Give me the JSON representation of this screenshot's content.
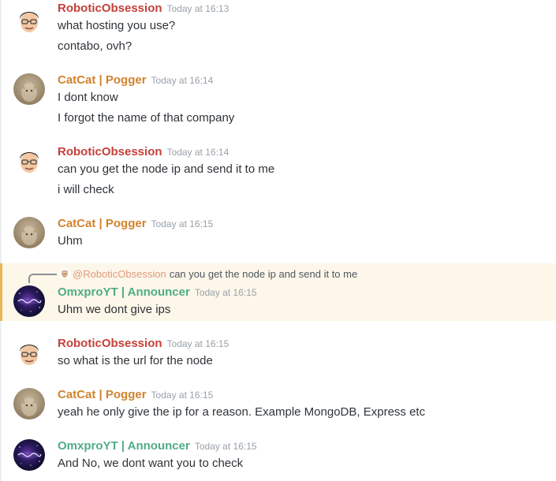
{
  "colors": {
    "robotic": "#c4413b",
    "catcat": "#d1832d",
    "omx": "#4fad86",
    "mention": "#e09a7a",
    "highlight_bg": "#fdf7ea",
    "highlight_bar": "#e8b657"
  },
  "messages": [
    {
      "avatar_icon": "cartoon-man-avatar-icon",
      "username": "RoboticObsession",
      "timestamp": "Today at 16:13",
      "lines": [
        "what hosting you use?",
        "contabo, ovh?"
      ]
    },
    {
      "avatar_icon": "cat-photo-avatar-icon",
      "username": "CatCat | Pogger",
      "timestamp": "Today at 16:14",
      "lines": [
        "I dont know",
        "I forgot the name of that company"
      ]
    },
    {
      "avatar_icon": "cartoon-man-avatar-icon",
      "username": "RoboticObsession",
      "timestamp": "Today at 16:14",
      "lines": [
        "can you get the node ip and send it to me",
        "i will check"
      ]
    },
    {
      "avatar_icon": "cat-photo-avatar-icon",
      "username": "CatCat | Pogger",
      "timestamp": "Today at 16:15",
      "lines": [
        "Uhm"
      ]
    },
    {
      "avatar_icon": "galaxy-logo-avatar-icon",
      "username": "OmxproYT | Announcer",
      "timestamp": "Today at 16:15",
      "reply": {
        "mention": "@RoboticObsession",
        "text": "can you get the node ip and send it to me"
      },
      "lines": [
        "Uhm we dont give ips"
      ]
    },
    {
      "avatar_icon": "cartoon-man-avatar-icon",
      "username": "RoboticObsession",
      "timestamp": "Today at 16:15",
      "lines": [
        "so what is the url for the node"
      ]
    },
    {
      "avatar_icon": "cat-photo-avatar-icon",
      "username": "CatCat | Pogger",
      "timestamp": "Today at 16:15",
      "lines": [
        "yeah he only give the ip for a reason. Example MongoDB, Express etc"
      ]
    },
    {
      "avatar_icon": "galaxy-logo-avatar-icon",
      "username": "OmxproYT | Announcer",
      "timestamp": "Today at 16:15",
      "lines": [
        "And No, we dont want you to check"
      ]
    }
  ]
}
